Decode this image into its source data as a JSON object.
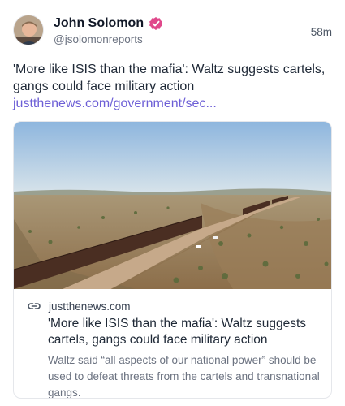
{
  "author": {
    "display_name": "John Solomon",
    "handle": "@jsolomonreports",
    "verified_icon": "verified-badge-icon",
    "verified_color": "#e0488b"
  },
  "post": {
    "time": "58m",
    "text": "'More like ISIS than the mafia': Waltz suggests cartels, gangs could face military action",
    "link_text": "justthenews.com/government/sec..."
  },
  "link_card": {
    "image_alt": "Border wall stretching across desert",
    "domain": "justthenews.com",
    "title": "'More like ISIS than the mafia': Waltz suggests cartels, gangs could face military action",
    "description": "Waltz said “all aspects of our national power” should be used to defeat threats from the cartels and transnational gangs."
  },
  "colors": {
    "link": "#6d5fd6",
    "text": "#1f2937",
    "muted": "#6b7280"
  }
}
